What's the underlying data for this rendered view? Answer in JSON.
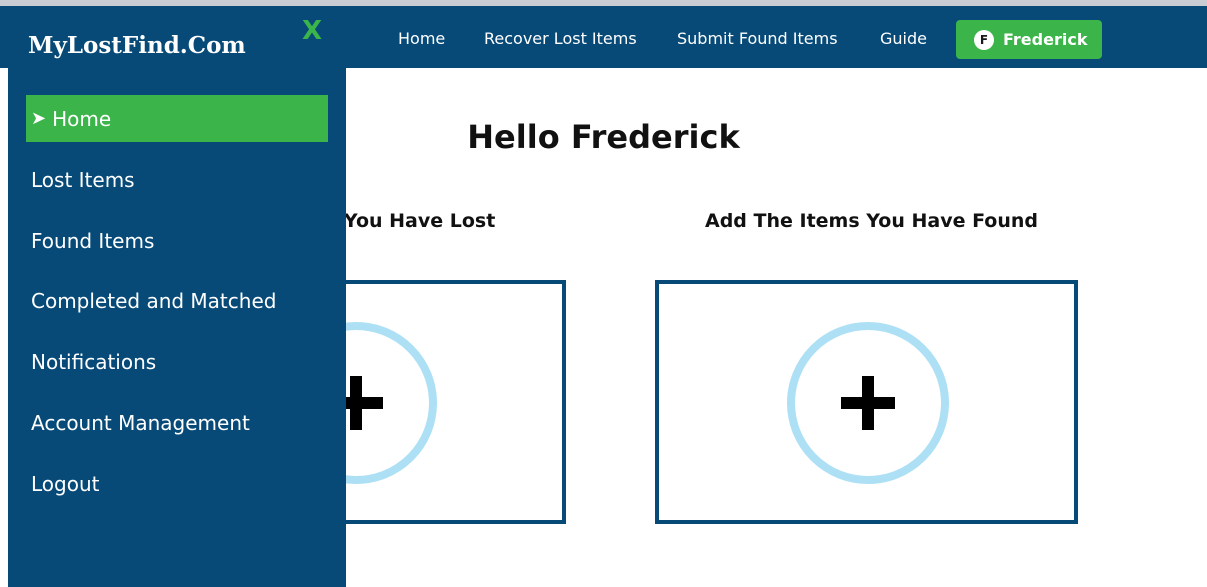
{
  "header": {
    "nav": [
      {
        "label": "Home"
      },
      {
        "label": "Recover Lost Items"
      },
      {
        "label": "Submit Found Items"
      },
      {
        "label": "Guide"
      }
    ],
    "user": {
      "initial": "F",
      "name": "Frederick"
    }
  },
  "sidebar": {
    "brand": "MyLostFind.Com",
    "close_label": "X",
    "active_marker": "➤",
    "items": [
      {
        "label": "Home",
        "active": true
      },
      {
        "label": "Lost Items"
      },
      {
        "label": "Found Items"
      },
      {
        "label": "Completed and Matched"
      },
      {
        "label": "Notifications"
      },
      {
        "label": "Account Management"
      },
      {
        "label": "Logout"
      }
    ]
  },
  "main": {
    "greeting": "Hello Frederick",
    "lost_label": "s You Have Lost",
    "found_label": "Add The Items You Have Found",
    "add_icon": "plus-icon"
  },
  "colors": {
    "brand_blue": "#074a78",
    "accent_green": "#3bb44a",
    "circle_light_blue": "#ade0f5"
  }
}
